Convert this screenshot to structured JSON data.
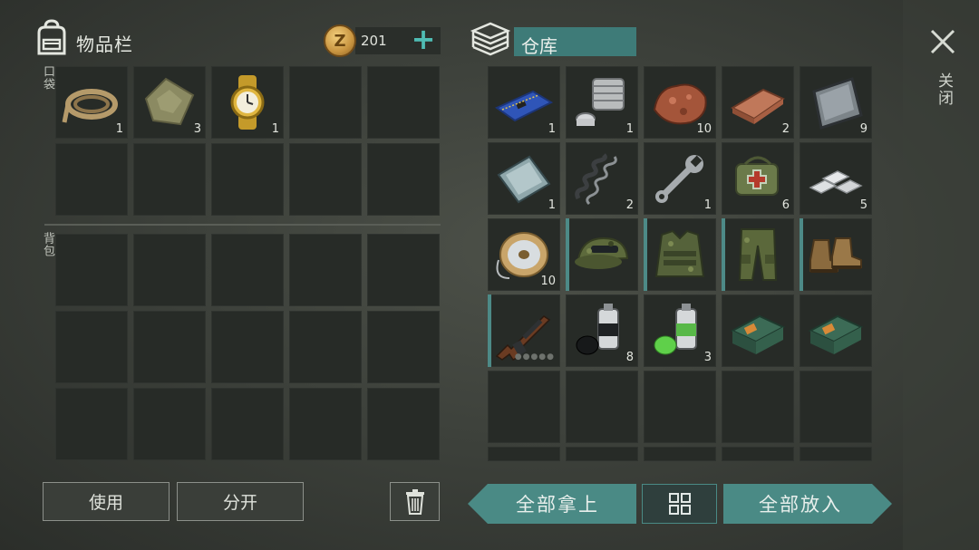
{
  "inventory": {
    "title": "物品栏",
    "coins": "201",
    "pocket_label": "口袋",
    "backpack_label": "背包",
    "pocket_items": [
      {
        "icon": "rope-icon",
        "qty": "1"
      },
      {
        "icon": "cloth-icon",
        "qty": "3"
      },
      {
        "icon": "gold-watch-icon",
        "qty": "1"
      }
    ]
  },
  "warehouse": {
    "title": "仓库",
    "items": [
      {
        "icon": "circuit-board-icon",
        "qty": "1"
      },
      {
        "icon": "engine-part-icon",
        "qty": "1"
      },
      {
        "icon": "copper-ore-icon",
        "qty": "10"
      },
      {
        "icon": "copper-ingot-icon",
        "qty": "2"
      },
      {
        "icon": "steel-plate-icon",
        "qty": "9"
      },
      {
        "icon": "glass-plate-icon",
        "qty": "1"
      },
      {
        "icon": "spring-icon",
        "qty": "2"
      },
      {
        "icon": "wrench-icon",
        "qty": "1"
      },
      {
        "icon": "medkit-bag-icon",
        "qty": "6"
      },
      {
        "icon": "silver-ingots-icon",
        "qty": "5"
      },
      {
        "icon": "wire-spool-icon",
        "qty": "10"
      },
      {
        "icon": "camo-cap-icon",
        "qty": ""
      },
      {
        "icon": "camo-vest-icon",
        "qty": ""
      },
      {
        "icon": "camo-pants-icon",
        "qty": ""
      },
      {
        "icon": "boots-icon",
        "qty": ""
      },
      {
        "icon": "ak-rifle-icon",
        "qty": ""
      },
      {
        "icon": "black-paint-can-icon",
        "qty": "8"
      },
      {
        "icon": "green-paint-can-icon",
        "qty": "3"
      },
      {
        "icon": "ammo-box-icon",
        "qty": ""
      },
      {
        "icon": "ammo-box-icon",
        "qty": ""
      }
    ]
  },
  "buttons": {
    "use": "使用",
    "split": "分开",
    "take_all": "全部拿上",
    "put_all": "全部放入",
    "close": "关闭"
  },
  "colors": {
    "accent_teal": "#4a8a85",
    "slot_bg": "#272b27"
  }
}
